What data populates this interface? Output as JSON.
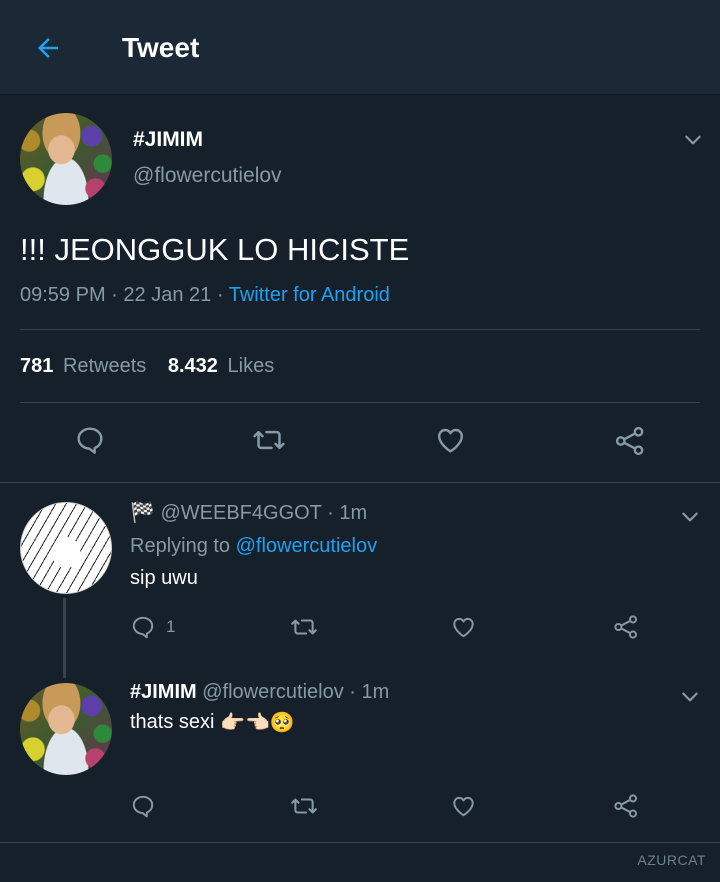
{
  "header": {
    "title": "Tweet",
    "back_icon": "arrow-left-icon"
  },
  "main_tweet": {
    "display_name": "#JIMIM",
    "handle": "@flowercutielov",
    "text": "!!! JEONGGUK LO HICISTE",
    "time": "09:59 PM",
    "date": "22 Jan 21",
    "separator": "·",
    "source": "Twitter for Android",
    "retweets_count": "781",
    "retweets_label": "Retweets",
    "likes_count": "8.432",
    "likes_label": "Likes"
  },
  "replies": [
    {
      "flag": "🏁",
      "handle": "@WEEBF4GGOT",
      "time": "· 1m",
      "replying_prefix": "Replying to",
      "replying_to": "@flowercutielov",
      "text": "sip uwu",
      "reply_count": "1"
    },
    {
      "display_name": "#JIMIM",
      "handle": "@flowercutielov",
      "time": "· 1m",
      "text": "thats sexi",
      "emojis": "👉🏻👈🏻🥺"
    }
  ],
  "watermark": "AZURCAT",
  "colors": {
    "background": "#15202b",
    "header_bg": "#1b2836",
    "accent": "#1da1f2",
    "muted": "#8899a6",
    "divider": "#38444d"
  },
  "icons": [
    "arrow-left-icon",
    "chevron-down-icon",
    "reply-icon",
    "retweet-icon",
    "like-icon",
    "share-icon"
  ]
}
